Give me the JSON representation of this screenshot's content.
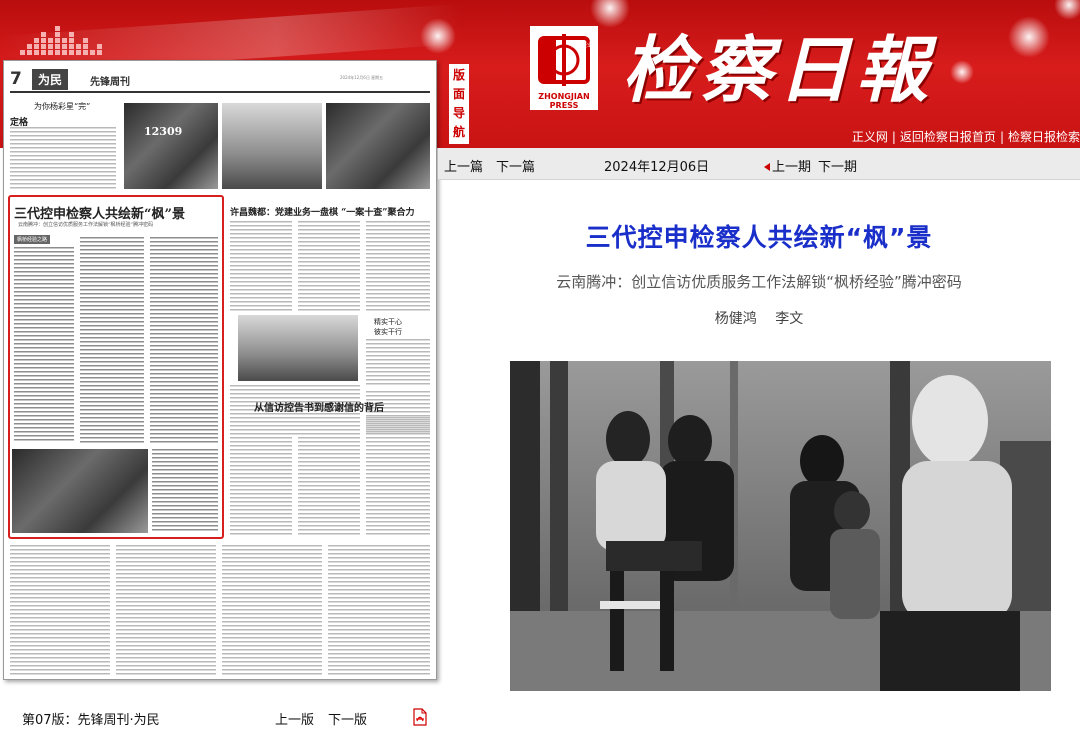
{
  "masthead": {
    "logo_caption": "ZHONGJIAN PRESS",
    "logo_badge": "中检报业",
    "title": "检察日報",
    "guide_badge": [
      "版",
      "面",
      "导",
      "航"
    ],
    "links": [
      "正义网",
      "返回检察日报首页",
      "检察日报检索"
    ],
    "colors": {
      "primary": "#c91313",
      "link_title": "#1a2fc9",
      "highlight_box": "#d81f1f"
    }
  },
  "thumbnail": {
    "page_number": "7",
    "section_tag": "为民",
    "weekly": "先锋周刊",
    "header_tiny": "2024年12月6日 星期五",
    "top_story_title": "为你杨彩星“完”",
    "top_story_drop": "定格",
    "photo_caption_left": "12309",
    "main_headline": "三代控申检察人共绘新“枫”景",
    "main_deck": "云南腾冲：创立信访优质服务工作法解锁“枫桥经验”腾冲密码",
    "side_headline": "许昌魏都：党建业务一盘棋 “一案十查”聚合力",
    "side_kicker1": "精实干心",
    "side_kicker2": "彼实干行",
    "bottom_headline": "从信访控告书到感谢信的背后",
    "box_label": "枫桥经验之路"
  },
  "toolbar": {
    "prev_article": "上一篇",
    "next_article": "下一篇",
    "date": "2024年12月06日",
    "prev_issue": "上一期",
    "next_issue": "下一期"
  },
  "article": {
    "title": "三代控申检察人共绘新“枫”景",
    "subtitle": "云南腾冲：创立信访优质服务工作法解锁“枫桥经验”腾冲密码",
    "authors": "杨健鸿 李文"
  },
  "footer": {
    "edition_label": "第07版：先锋周刊·为民",
    "prev_page": "上一版",
    "next_page": "下一版",
    "pdf_icon": "pdf-icon"
  }
}
